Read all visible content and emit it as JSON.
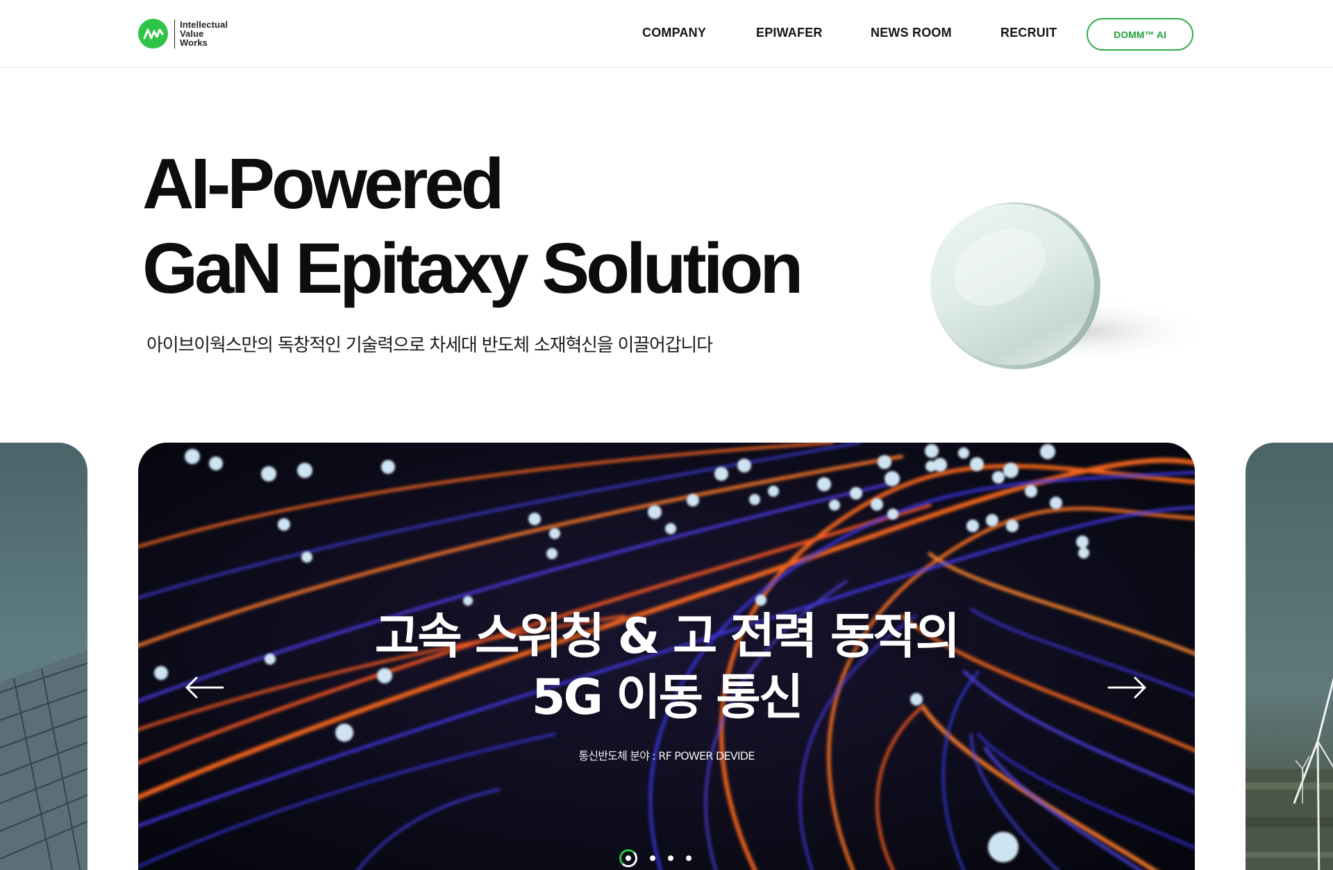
{
  "header": {
    "logo": {
      "line1": "Intellectual",
      "line2": "Value",
      "line3": "Works"
    },
    "nav": [
      {
        "label": "COMPANY"
      },
      {
        "label": "EPIWAFER"
      },
      {
        "label": "NEWS ROOM"
      },
      {
        "label": "RECRUIT"
      }
    ],
    "cta_label": "DOMM™ AI"
  },
  "hero": {
    "title_line1": "AI-Powered",
    "title_line2": "GaN Epitaxy Solution",
    "subtitle": "아이브이웍스만의 독창적인 기술력으로 차세대 반도체 소재혁신을 이끌어갑니다"
  },
  "carousel": {
    "slide": {
      "title_line1": "고속 스위칭 & 고 전력 동작의",
      "title_line2": "5G 이동 통신",
      "caption": "통신반도체 분야 : RF POWER DEVIDE"
    },
    "dot_count": 4,
    "active_index": 0
  },
  "colors": {
    "brand_green": "#2ec448",
    "cta_border": "#2fae4a",
    "text_dark": "#0d0d0d"
  },
  "icons": {
    "prev": "arrow-left-icon",
    "next": "arrow-right-icon"
  }
}
